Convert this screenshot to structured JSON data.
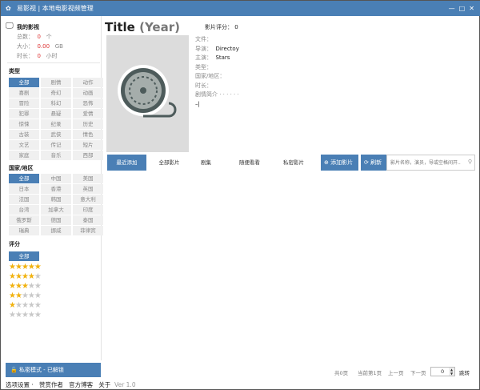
{
  "window": {
    "title": "易影视 | 本地电影视频管理"
  },
  "stats": {
    "heading": "我的影视",
    "total_label": "总数：",
    "total_value": "0",
    "total_unit": "个",
    "size_label": "大小：",
    "size_value": "0.00",
    "size_unit": "GB",
    "duration_label": "时长：",
    "duration_value": "0",
    "duration_unit": "小时"
  },
  "genre": {
    "heading": "类型",
    "items": [
      "全部",
      "剧情",
      "动作",
      "喜剧",
      "奇幻",
      "动画",
      "冒险",
      "科幻",
      "恐怖",
      "犯罪",
      "悬疑",
      "爱情",
      "惊悚",
      "纪录",
      "历史",
      "古装",
      "武侠",
      "情色",
      "文艺",
      "传记",
      "短片",
      "家庭",
      "音乐",
      "西部"
    ]
  },
  "region": {
    "heading": "国家/地区",
    "items": [
      "全部",
      "中国",
      "美国",
      "日本",
      "香港",
      "英国",
      "法国",
      "韩国",
      "意大利",
      "台湾",
      "加拿大",
      "印度",
      "俄罗斯",
      "德国",
      "泰国",
      "瑞典",
      "挪威",
      "菲律宾"
    ]
  },
  "rating": {
    "heading": "评分",
    "all": "全部",
    "levels": [
      5,
      4,
      3,
      2,
      1,
      0
    ],
    "star_color": "#f1b20f"
  },
  "private_mode": "私密模式 - 已解锁",
  "footer": {
    "settings": "选项设置 ·",
    "donate": "赞赏作者",
    "blog": "官方博客",
    "about": "关于",
    "version": "Ver 1.0"
  },
  "movie": {
    "title": "Title",
    "year": "(Year)",
    "score_label": "影片评分：",
    "score": "0",
    "file_label": "文件：",
    "director_label": "导演：",
    "director": "Directoy",
    "stars_label": "主演：",
    "stars": "Stars",
    "type_label": "类型：",
    "region_label": "国家/地区：",
    "duration_label": "时长：",
    "plot_label": "剧情简介 · · · · · ·"
  },
  "tabs": [
    "最近添加",
    "全部影片",
    "剧集",
    "随便看看",
    "私密影片"
  ],
  "actions": {
    "add": "添加影片",
    "refresh": "刷新",
    "search_placeholder": "影片名称，演员，导或空格间开..."
  },
  "pagination": {
    "total": "共0页",
    "current": "当前第1页",
    "prev": "上一页",
    "next": "下一页",
    "page_value": "0",
    "jump": "跳转"
  },
  "accent": "#4a7fb5"
}
